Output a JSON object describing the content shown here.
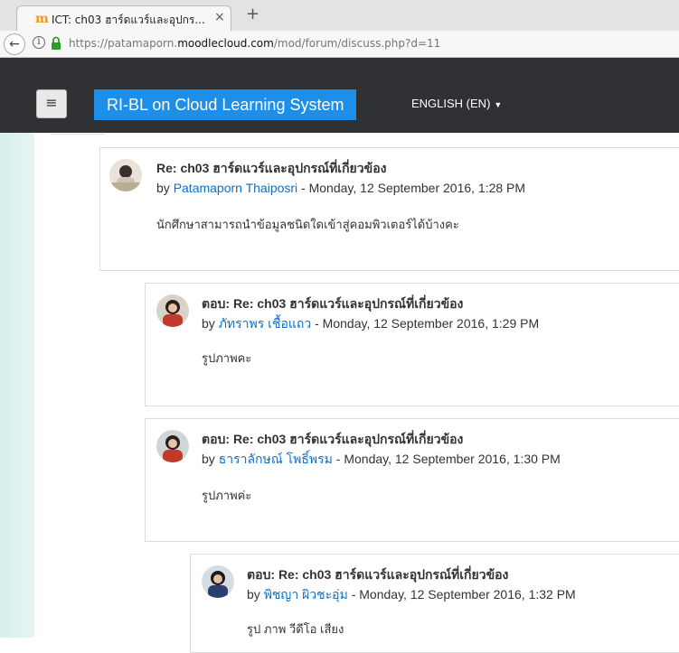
{
  "browser": {
    "tab_title": "ICT: ch03 ฮาร์ดแวร์และอุปกร...",
    "tab_close": "×",
    "new_tab": "+",
    "url_prefix": "https://patamaporn.",
    "url_host": "moodlecloud.com",
    "url_path": "/mod/forum/discuss.php?d=11"
  },
  "header": {
    "menu_icon": "hamburger-icon",
    "site_name": "RI-BL on Cloud Learning System",
    "language": "ENGLISH (EN)"
  },
  "posts": [
    {
      "subject": "Re: ch03 ฮาร์ดแวร์และอุปกรณ์ที่เกี่ยวข้อง",
      "by": "by",
      "author": "Patamaporn Thaiposri",
      "date": " - Monday, 12 September 2016, 1:28 PM",
      "message": "นักศึกษาสามารถนำข้อมูลชนิดใดเข้าสู่คอมพิวเตอร์ได้บ้างคะ"
    },
    {
      "subject": "ตอบ: Re: ch03 ฮาร์ดแวร์และอุปกรณ์ที่เกี่ยวข้อง",
      "by": "by",
      "author": "ภัทราพร เชื้อแถว",
      "date": " - Monday, 12 September 2016, 1:29 PM",
      "message": "รูปภาพคะ"
    },
    {
      "subject": "ตอบ: Re: ch03 ฮาร์ดแวร์และอุปกรณ์ที่เกี่ยวข้อง",
      "by": "by",
      "author": "ธาราลักษณ์ โพธิ์พรม",
      "date": " - Monday, 12 September 2016, 1:30 PM",
      "message": "รูปภาพค่ะ"
    },
    {
      "subject": "ตอบ: Re: ch03 ฮาร์ดแวร์และอุปกรณ์ที่เกี่ยวข้อง",
      "by": "by",
      "author": "พิชญา ผิวชะอุ่ม",
      "date": " - Monday, 12 September 2016, 1:32 PM",
      "message": "รูป ภาพ วีดีโอ เสียง"
    }
  ],
  "colors": {
    "header_bg": "#2f3134",
    "site_button": "#1e8fe8",
    "link": "#0f6fc5"
  }
}
